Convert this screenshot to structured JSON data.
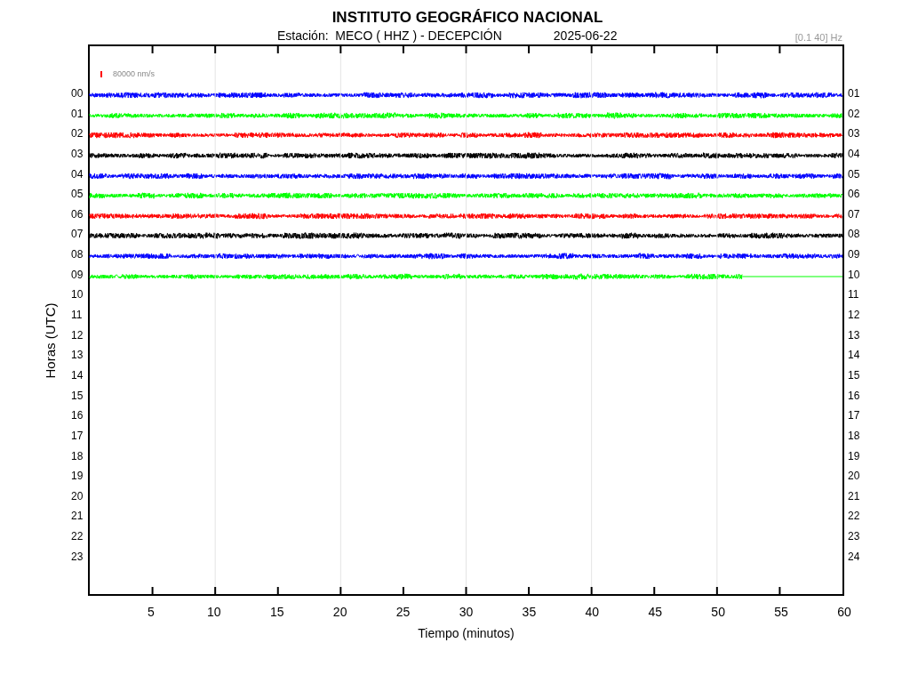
{
  "title": "INSTITUTO GEOGRÁFICO NACIONAL",
  "station": "Estación:  MECO ( HHZ ) - DECEPCIÓN",
  "date": "2025-06-22",
  "filter": "[0.1 40] Hz",
  "scale_label": "80000 nm/s",
  "ylabel": "Horas (UTC)",
  "xlabel": "Tiempo (minutos)",
  "xtick_labels": [
    "5",
    "10",
    "15",
    "20",
    "25",
    "30",
    "35",
    "40",
    "45",
    "50",
    "55",
    "60"
  ],
  "left_labels": [
    "00",
    "01",
    "02",
    "03",
    "04",
    "05",
    "06",
    "07",
    "08",
    "09",
    "10",
    "11",
    "12",
    "13",
    "14",
    "15",
    "16",
    "17",
    "18",
    "19",
    "20",
    "21",
    "22",
    "23"
  ],
  "right_labels": [
    "01",
    "02",
    "03",
    "04",
    "05",
    "06",
    "07",
    "08",
    "09",
    "10",
    "11",
    "12",
    "13",
    "14",
    "15",
    "16",
    "17",
    "18",
    "19",
    "20",
    "21",
    "22",
    "23",
    "24"
  ],
  "traces": [
    {
      "color": "#0000ff",
      "level": 1
    },
    {
      "color": "#00ff00",
      "level": 1
    },
    {
      "color": "#ff0000",
      "level": 1
    },
    {
      "color": "#000000",
      "level": 1
    },
    {
      "color": "#0000ff",
      "level": 1
    },
    {
      "color": "#00ff00",
      "level": 1
    },
    {
      "color": "#ff0000",
      "level": 1
    },
    {
      "color": "#000000",
      "level": 1
    },
    {
      "color": "#0000ff",
      "level": 1
    },
    {
      "color": "#00ff00",
      "level": 0.867
    }
  ]
}
